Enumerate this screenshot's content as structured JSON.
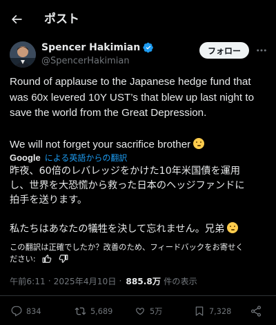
{
  "header": {
    "back_icon": "arrow-left-icon",
    "title": "ポスト"
  },
  "author": {
    "name": "Spencer Hakimian",
    "handle": "@SpencerHakimian",
    "verified": true,
    "avatar_icon": "avatar-photo",
    "follow_label": "フォロー",
    "more_icon": "more-horizontal-icon"
  },
  "tweet": {
    "lines": [
      "Round of applause to the Japanese hedge fund that",
      "was 60x levered 10Y UST’s that blew up last night to",
      "save the world from the Great Depression."
    ],
    "line2": "We will not forget your sacrifice brother",
    "emoji": "saluting-face-emoji"
  },
  "translation": {
    "provider": "Google",
    "link": "による英語からの翻訳",
    "lines": [
      "昨夜、60倍のレバレッジをかけた10年米国債を運用",
      "し、世界を大恐慌から救った日本のヘッジファンドに",
      "拍手を送ります。"
    ],
    "line2": "私たちはあなたの犠牲を決して忘れません。兄弟",
    "feedback_line1": "この翻訳は正確でしたか？改善のため、フィードバックをお寄せく",
    "feedback_line2": "ださい:"
  },
  "meta": {
    "time": "午前6:11",
    "separator": "·",
    "date": "2025年4月10日",
    "views": "885.8万",
    "views_label": "件の表示"
  },
  "actions": {
    "replies": "834",
    "reposts": "5,689",
    "likes": "5万",
    "bookmarks": "7,328",
    "share_icon": "share-icon"
  },
  "colors": {
    "background": "#000000",
    "text": "#e7e9ea",
    "secondary": "#71767b",
    "link": "#1d9bf0",
    "verified": "#1d9bf0",
    "follow_bg": "#eff3f4"
  }
}
